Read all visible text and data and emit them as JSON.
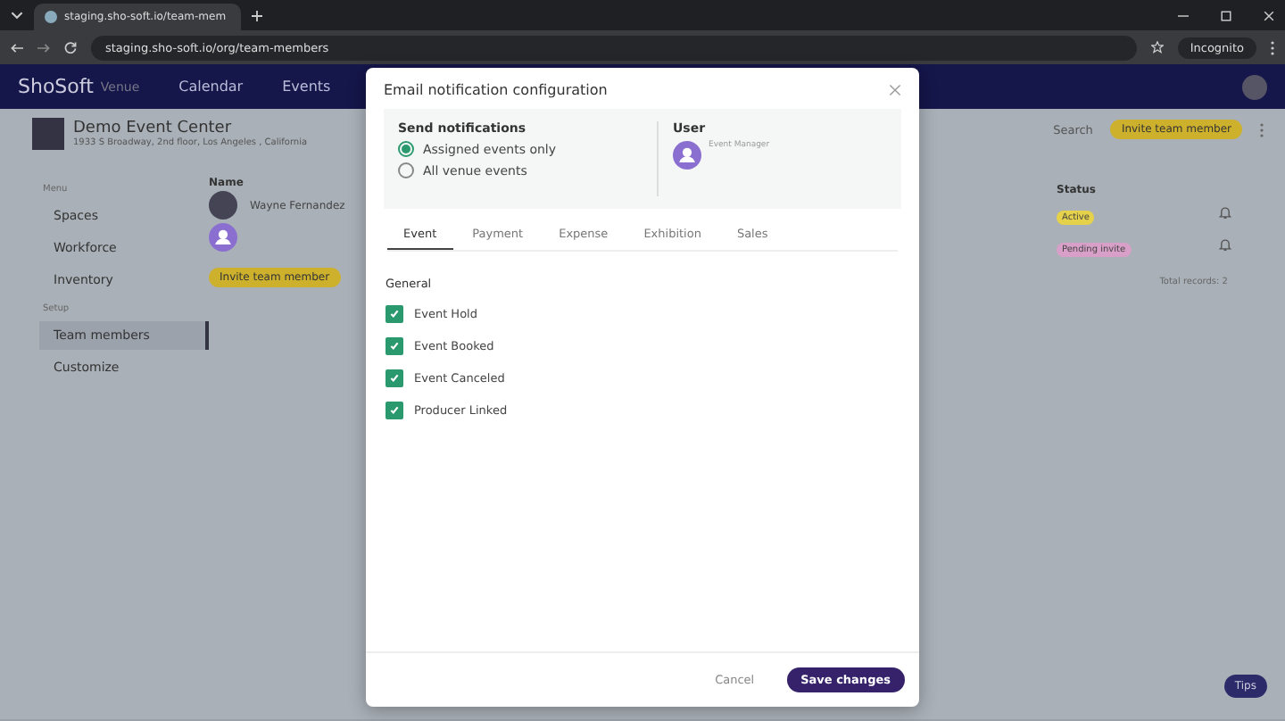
{
  "browser": {
    "tab_title": "staging.sho-soft.io/team-mem",
    "url": "staging.sho-soft.io/org/team-members",
    "profile": "Incognito"
  },
  "nav": {
    "logo": "ShoSoft",
    "logo_sub": "Venue",
    "items": [
      "Calendar",
      "Events"
    ]
  },
  "venue": {
    "name": "Demo Event Center",
    "address": "1933 S Broadway, 2nd floor, Los Angeles , California"
  },
  "sidebar": [
    {
      "heading": "Menu",
      "items": [
        {
          "label": "Spaces",
          "selected": false
        },
        {
          "label": "Workforce",
          "selected": false
        },
        {
          "label": "Inventory",
          "selected": false
        }
      ]
    },
    {
      "heading": "Setup",
      "items": [
        {
          "label": "Team members",
          "selected": true
        },
        {
          "label": "Customize",
          "selected": false
        }
      ]
    }
  ],
  "toolbar": {
    "search": "Search",
    "invite": "Invite team member"
  },
  "table": {
    "columns": [
      "Name",
      "Status"
    ],
    "rows": [
      {
        "name": "Wayne Fernandez",
        "photo": true,
        "status": "Active",
        "color": "#e6d24a"
      },
      {
        "photo": false,
        "status": "Pending invite",
        "color": "#d8a0c8"
      }
    ],
    "invite_button": "Invite team member",
    "total": "Total records: 2"
  },
  "tips": "Tips",
  "dialog": {
    "title": "Email notification configuration",
    "send_notifications": {
      "heading": "Send notifications",
      "options": [
        {
          "label": "Assigned events only",
          "selected": true
        },
        {
          "label": "All venue events",
          "selected": false
        }
      ]
    },
    "user": {
      "heading": "User",
      "role": "Event Manager"
    },
    "tabs": [
      {
        "label": "Event",
        "selected": true
      },
      {
        "label": "Payment",
        "selected": false
      },
      {
        "label": "Expense",
        "selected": false
      },
      {
        "label": "Exhibition",
        "selected": false
      },
      {
        "label": "Sales",
        "selected": false
      }
    ],
    "section": "General",
    "checkboxes": [
      {
        "label": "Event Hold",
        "checked": true
      },
      {
        "label": "Event Booked",
        "checked": true
      },
      {
        "label": "Event Canceled",
        "checked": true
      },
      {
        "label": "Producer Linked",
        "checked": true
      }
    ],
    "cancel": "Cancel",
    "save": "Save changes"
  }
}
